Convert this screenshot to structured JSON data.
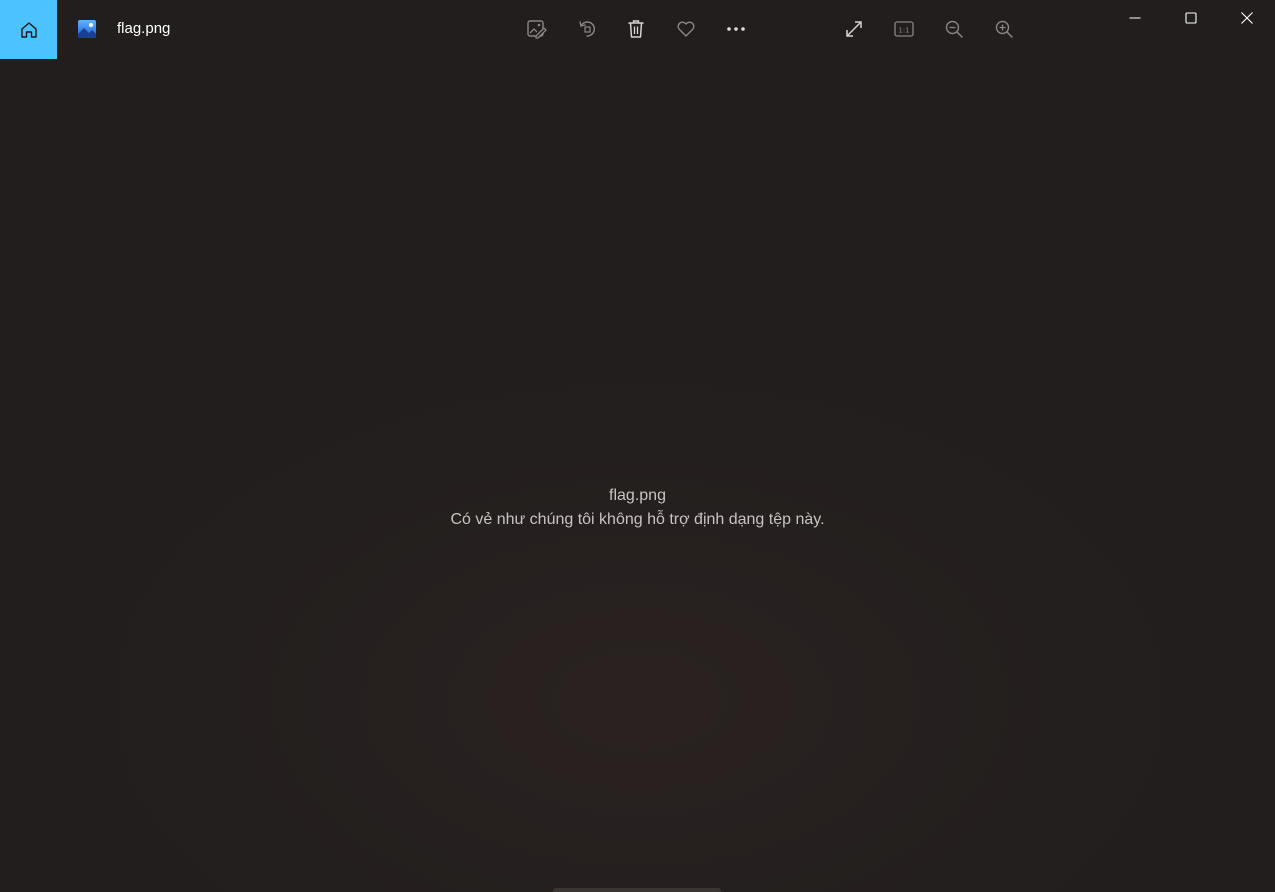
{
  "titlebar": {
    "file_name": "flag.png"
  },
  "toolbar": {
    "items": [
      {
        "name": "edit-image",
        "icon": "edit-image-icon"
      },
      {
        "name": "rotate",
        "icon": "rotate-icon"
      },
      {
        "name": "delete",
        "icon": "trash-icon"
      },
      {
        "name": "favorite",
        "icon": "heart-icon"
      },
      {
        "name": "more",
        "icon": "more-icon"
      },
      {
        "name": "fullscreen",
        "icon": "expand-icon"
      },
      {
        "name": "actual-size",
        "icon": "one-to-one-icon",
        "label": "1:1"
      },
      {
        "name": "zoom-out",
        "icon": "zoom-out-icon"
      },
      {
        "name": "zoom-in",
        "icon": "zoom-in-icon"
      }
    ]
  },
  "window_controls": [
    "minimize",
    "maximize",
    "close"
  ],
  "message": {
    "file_name": "flag.png",
    "error": "Có vẻ như chúng tôi không hỗ trợ định dạng tệp này."
  },
  "colors": {
    "accent": "#4cc2ff",
    "background": "#221f1e",
    "text": "#c8c3c1",
    "icon": "#8a8583"
  }
}
